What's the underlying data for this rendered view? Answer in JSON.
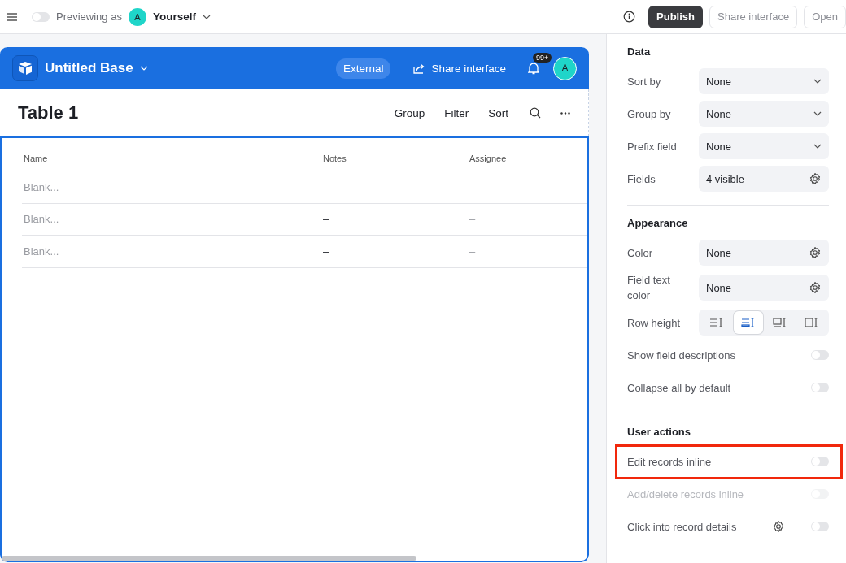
{
  "topbar": {
    "preview_toggle_on": false,
    "previewing_label": "Previewing as",
    "avatar_initial": "A",
    "user": "Yourself",
    "publish": "Publish",
    "share": "Share interface",
    "open": "Open"
  },
  "app": {
    "title": "Untitled Base",
    "badge": "External",
    "share": "Share interface",
    "notifications": "99+",
    "avatar_initial": "A"
  },
  "table": {
    "title": "Table 1",
    "actions": [
      "Group",
      "Filter",
      "Sort"
    ],
    "columns": [
      {
        "label": "Name",
        "muted": true
      },
      {
        "label": "Notes",
        "muted": false
      },
      {
        "label": "Assignee",
        "muted": true
      }
    ],
    "rows": [
      [
        "Blank...",
        "–",
        "–"
      ],
      [
        "Blank...",
        "–",
        "–"
      ],
      [
        "Blank...",
        "–",
        "–"
      ]
    ]
  },
  "panel": {
    "sections": [
      {
        "title": "Data",
        "items": [
          {
            "kind": "select",
            "label": "Sort by",
            "value": "None"
          },
          {
            "kind": "select",
            "label": "Group by",
            "value": "None"
          },
          {
            "kind": "select",
            "label": "Prefix field",
            "value": "None"
          },
          {
            "kind": "gear",
            "label": "Fields",
            "value": "4 visible"
          }
        ]
      },
      {
        "title": "Appearance",
        "items": [
          {
            "kind": "gear",
            "label": "Color",
            "value": "None"
          },
          {
            "kind": "gear",
            "label": "Field text color",
            "value": "None"
          },
          {
            "kind": "segmented",
            "label": "Row height",
            "options": [
              {
                "kind": "short",
                "selected": false
              },
              {
                "kind": "medium",
                "selected": true
              },
              {
                "kind": "tall",
                "selected": false
              },
              {
                "kind": "extra-tall",
                "selected": false
              }
            ]
          },
          {
            "kind": "toggle",
            "label": "Show field descriptions",
            "on": false,
            "disabled": false,
            "highlighted": false,
            "gear": false
          },
          {
            "kind": "toggle",
            "label": "Collapse all by default",
            "on": false,
            "disabled": false,
            "highlighted": false,
            "gear": false
          }
        ]
      },
      {
        "title": "User actions",
        "items": [
          {
            "kind": "toggle",
            "label": "Edit records inline",
            "on": false,
            "disabled": false,
            "highlighted": true,
            "gear": false
          },
          {
            "kind": "toggle",
            "label": "Add/delete records inline",
            "on": false,
            "disabled": true,
            "highlighted": false,
            "gear": false
          },
          {
            "kind": "toggle",
            "label": "Click into record details",
            "on": false,
            "disabled": false,
            "highlighted": false,
            "gear": true
          }
        ]
      }
    ]
  }
}
